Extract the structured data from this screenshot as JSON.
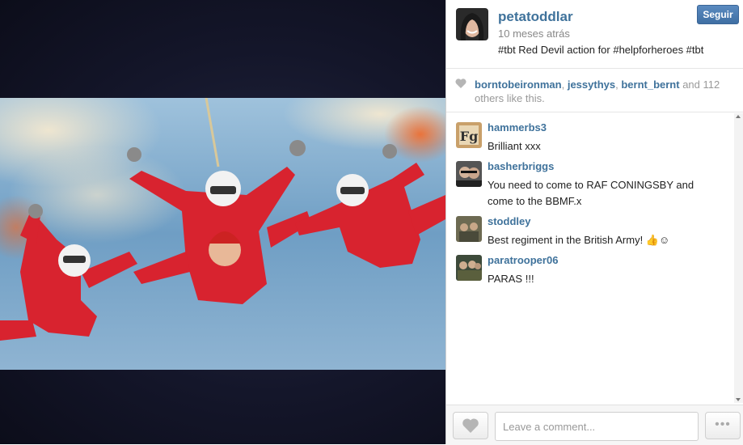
{
  "post": {
    "username": "petatoddlar",
    "time_ago": "10 meses atrás",
    "caption": "#tbt Red Devil action for #helpforheroes #tbt",
    "follow_label": "Seguir"
  },
  "likes": {
    "users": [
      "borntobeironman",
      "jessythys",
      "bernt_bernt"
    ],
    "sep1": ", ",
    "sep2": ", ",
    "and_text": " and ",
    "count": "112",
    "suffix": "others like this."
  },
  "comments": [
    {
      "username": "hammerbs3",
      "text": "Brilliant xxx"
    },
    {
      "username": "basherbriggs",
      "text": "You need to come to RAF CONINGSBY and come to the BBMF.x"
    },
    {
      "username": "stoddley",
      "text": "Best regiment in the British Army! 👍☺"
    },
    {
      "username": "paratrooper06",
      "text": "PARAS !!!"
    }
  ],
  "footer": {
    "comment_placeholder": "Leave a comment...",
    "more_label": "•••"
  },
  "icons": {
    "like": "heart-icon",
    "more": "ellipsis-icon"
  },
  "colors": {
    "link": "#3f729b",
    "follow_button": "#4b7cb0",
    "jumpsuit": "#d8232f"
  }
}
